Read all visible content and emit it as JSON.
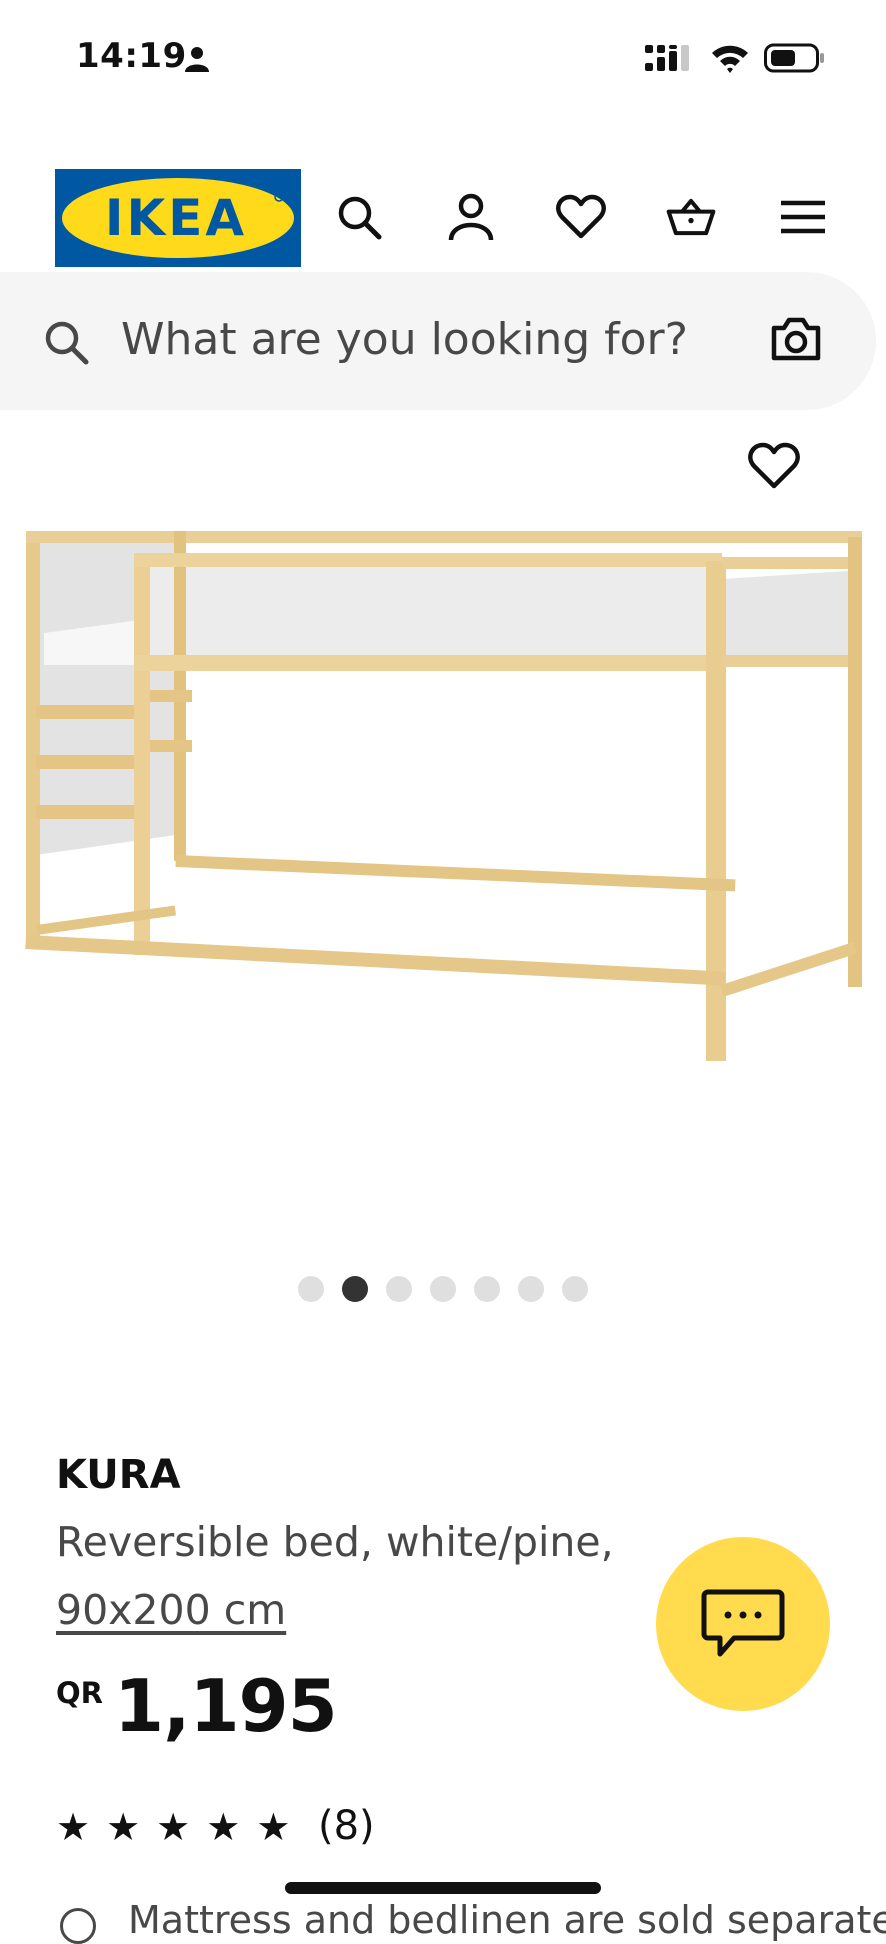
{
  "status_bar": {
    "time": "14:19",
    "icons": [
      "person-icon",
      "cellular-signal-icon",
      "wifi-icon",
      "battery-icon"
    ]
  },
  "header": {
    "logo_text": "IKEA",
    "brand_colors": {
      "blue": "#0058a3",
      "yellow": "#ffda1a"
    },
    "icons": [
      "search-icon",
      "account-icon",
      "favourites-heart-icon",
      "shopping-basket-icon",
      "hamburger-menu-icon"
    ]
  },
  "search": {
    "placeholder": "What are you looking for?",
    "icons": [
      "search-icon",
      "camera-icon"
    ]
  },
  "gallery": {
    "image_alt": "KURA reversible bed, white/pine",
    "dot_count": 7,
    "active_index": 1
  },
  "product": {
    "name": "KURA",
    "description": "Reversible bed, white/pine,",
    "size": "90x200 cm",
    "currency": "QR",
    "price": "1,195",
    "rating_stars": 5,
    "review_count": "(8)",
    "next_line_partial": "Mattress and bedlinen are sold separately"
  },
  "chat": {
    "icon": "chat-bubble-icon",
    "color": "#ffdb4d"
  },
  "colors": {
    "text_primary": "#111111",
    "text_secondary": "#484848",
    "search_bg": "#f5f5f5",
    "dot_inactive": "#dfdfdf",
    "dot_active": "#333333"
  }
}
